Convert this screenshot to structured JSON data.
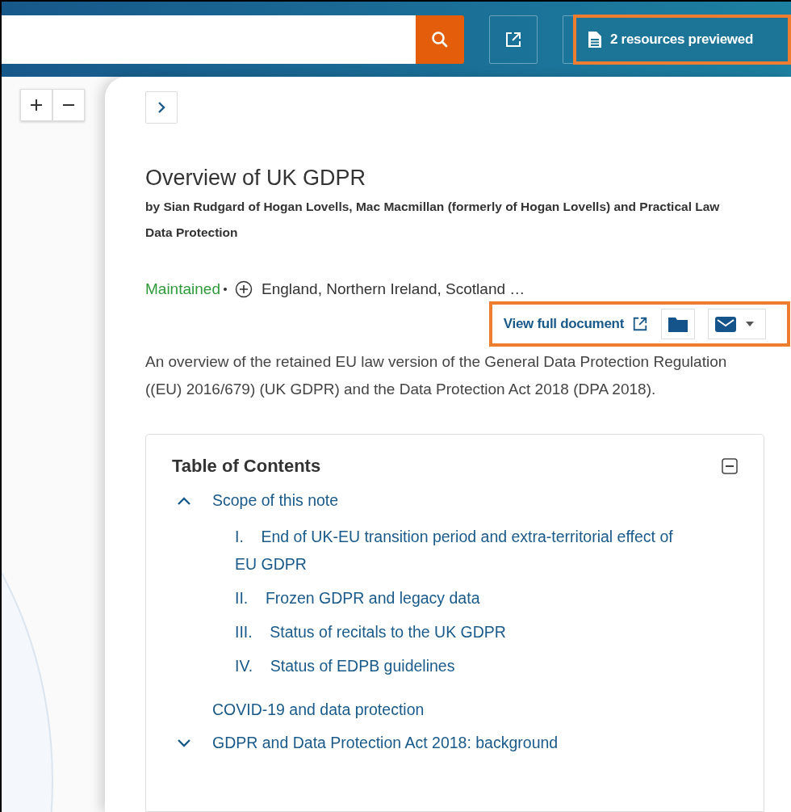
{
  "top_bar": {
    "resources_button": {
      "label": "2 resources previewed",
      "highlighted": true
    }
  },
  "document": {
    "title": "Overview of UK GDPR",
    "authors": "by Sian Rudgard of Hogan Lovells, Mac Macmillan (formerly of Hogan Lovells) and Practical Law Data Protection",
    "status": "Maintained",
    "jurisdictions": "England, Northern Ireland, Scotland …",
    "actions": {
      "view_full_document": "View full document",
      "highlighted": true
    },
    "summary": "An overview of the retained EU law version of the General Data Protection Regulation ((EU) 2016/679) (UK GDPR) and the Data Protection Act 2018 (DPA 2018)."
  },
  "toc": {
    "title": "Table of Contents",
    "expanded": true,
    "items": [
      {
        "label": "Scope of this note",
        "kind": "section",
        "expanded": true,
        "children": [
          {
            "number": "I.",
            "label": "End of UK-EU transition period and extra-territorial effect of EU GDPR"
          },
          {
            "number": "II.",
            "label": "Frozen GDPR and legacy data"
          },
          {
            "number": "III.",
            "label": "Status of recitals to the UK GDPR"
          },
          {
            "number": "IV.",
            "label": "Status of EDPB guidelines"
          }
        ]
      },
      {
        "label": "COVID-19 and data protection",
        "kind": "leaf"
      },
      {
        "label": "GDPR and Data Protection Act 2018: background",
        "kind": "section",
        "expanded": false
      }
    ]
  }
}
